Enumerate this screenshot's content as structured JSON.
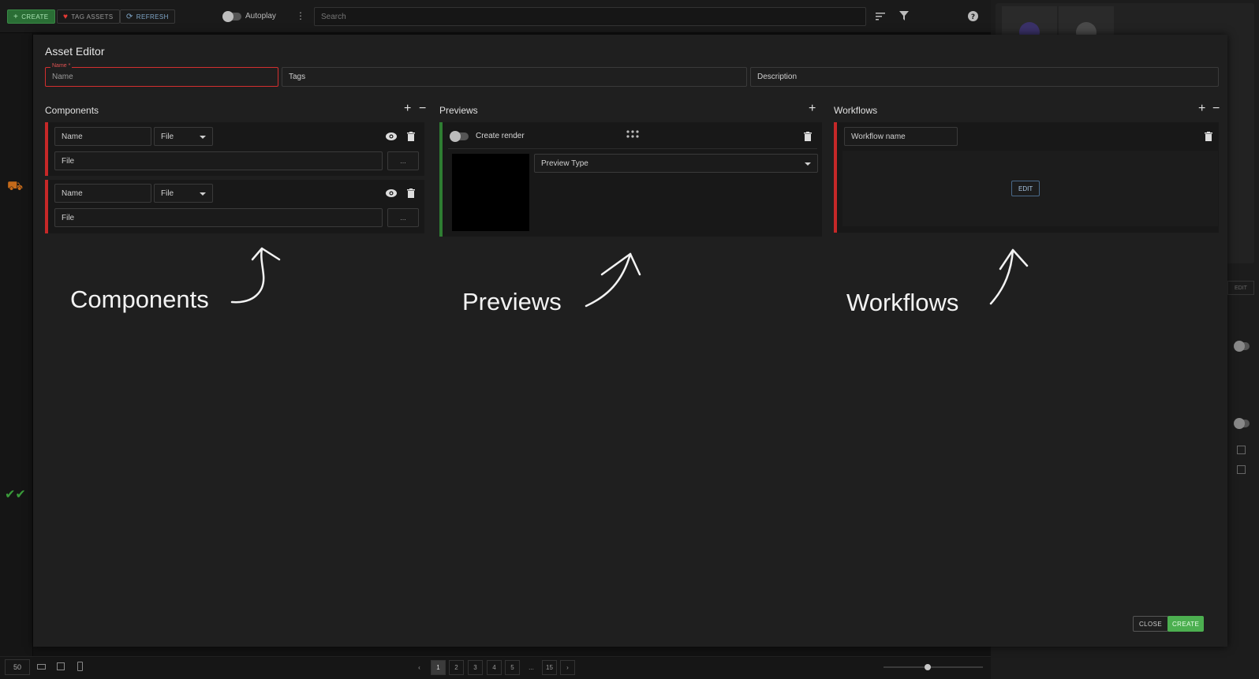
{
  "toolbar": {
    "create_label": "CREATE",
    "tag_assets_label": "TAG ASSETS",
    "refresh_label": "REFRESH",
    "autoplay_label": "Autoplay",
    "search_placeholder": "Search"
  },
  "modal": {
    "title": "Asset Editor",
    "name_label": "Name *",
    "name_placeholder": "Name",
    "tags_placeholder": "Tags",
    "description_placeholder": "Description",
    "components": {
      "title": "Components",
      "items": [
        {
          "name_placeholder": "Name",
          "type": "File",
          "file_placeholder": "File",
          "browse_label": "..."
        },
        {
          "name_placeholder": "Name",
          "type": "File",
          "file_placeholder": "File",
          "browse_label": "..."
        }
      ]
    },
    "previews": {
      "title": "Previews",
      "create_render_label": "Create render",
      "preview_type_label": "Preview Type"
    },
    "workflows": {
      "title": "Workflows",
      "workflow_name_placeholder": "Workflow name",
      "edit_label": "EDIT"
    },
    "close_label": "CLOSE",
    "create_label": "CREATE"
  },
  "annotations": {
    "components": "Components",
    "previews": "Previews",
    "workflows": "Workflows"
  },
  "pagination": {
    "page_size": "50",
    "pages": [
      "1",
      "2",
      "3",
      "4",
      "5"
    ],
    "ellipsis": "...",
    "last_page": "15",
    "current_page": "1"
  },
  "right_panel": {
    "edit_label": "EDIT"
  },
  "colors": {
    "accent_green": "#4caf50",
    "error_red": "#d32f2f",
    "card_red": "#c62828",
    "card_green": "#2e7d32"
  }
}
